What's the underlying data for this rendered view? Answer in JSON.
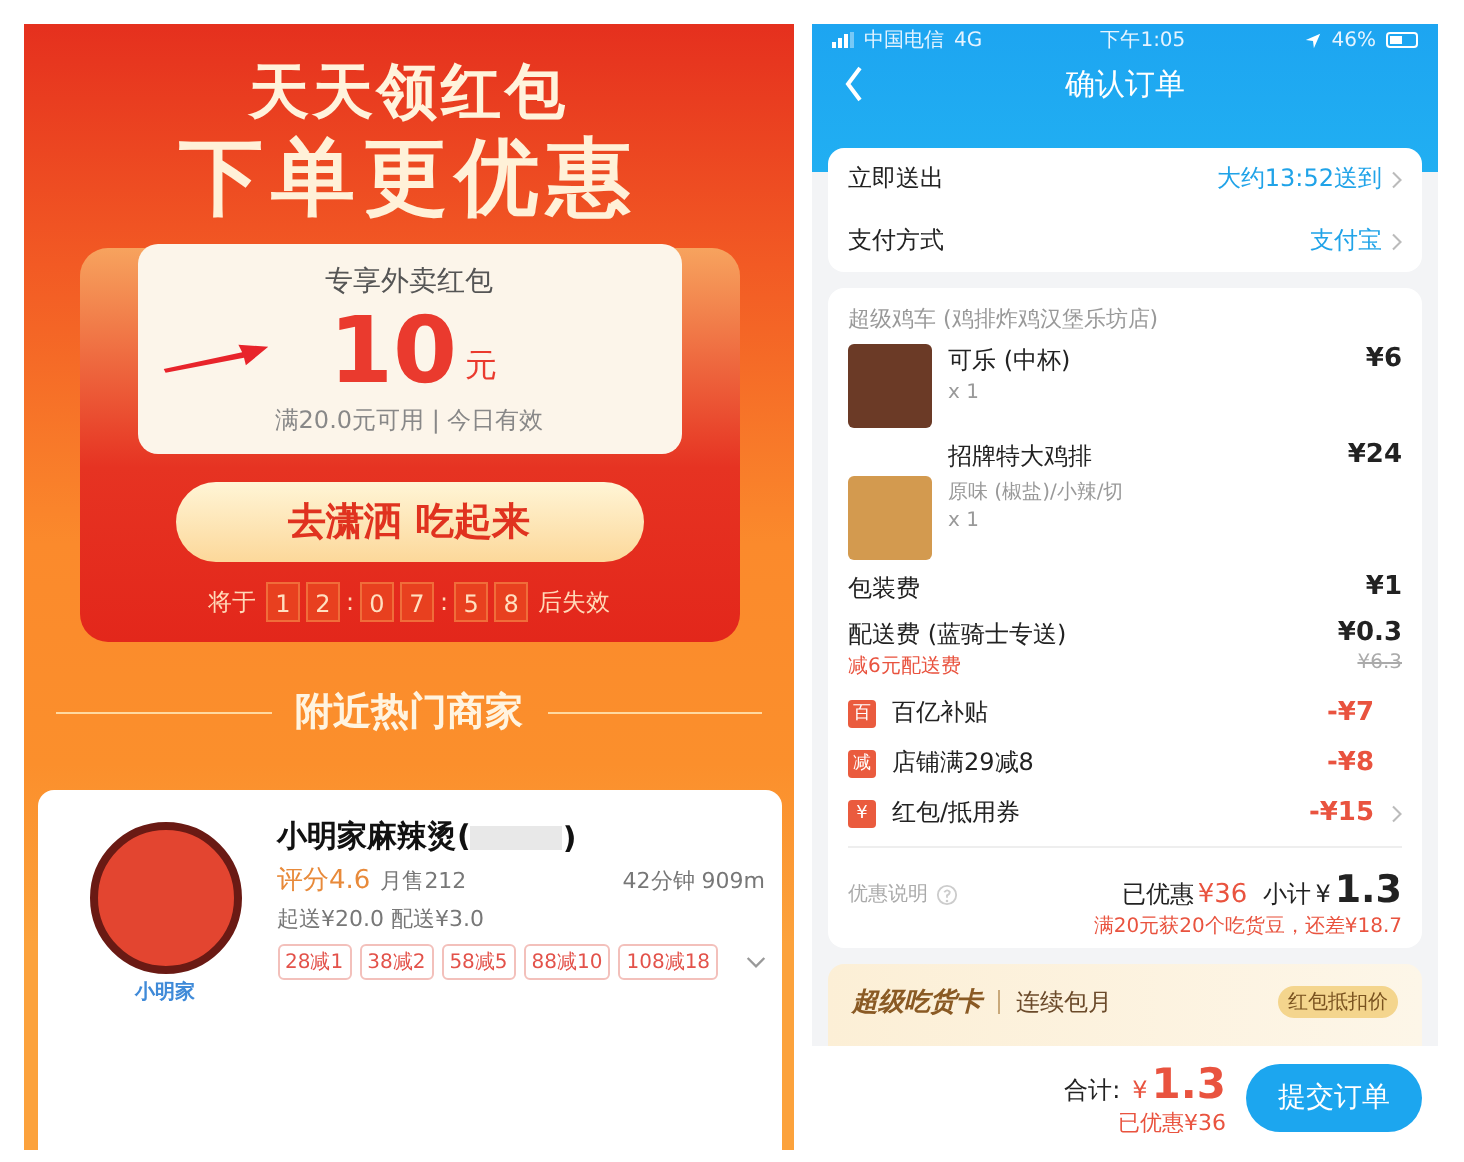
{
  "left_panel": {
    "banner": {
      "title_top": "天天领红包",
      "title_bottom": "下单更优惠"
    },
    "coupon": {
      "label": "专享外卖红包",
      "amount": "10",
      "unit": "元",
      "terms": "满20.0元可用 | 今日有效"
    },
    "cta_button": "去潇洒 吃起来",
    "countdown": {
      "prefix": "将于",
      "digits": [
        "1",
        "2",
        "0",
        "7",
        "5",
        "8"
      ],
      "separator": ":",
      "suffix": "后失效"
    },
    "section_title": "附近热门商家",
    "store": {
      "logo_text": "小明家",
      "name_start": "小明家麻辣烫(",
      "name_end": ")",
      "rating": "评分4.6",
      "monthly_sales": "月售212",
      "eta": "42分钟 909m",
      "fees": "起送¥20.0 配送¥3.0",
      "tags": [
        "28减1",
        "38减2",
        "58减5",
        "88减10",
        "108减18"
      ]
    }
  },
  "right_panel": {
    "status_bar": {
      "carrier": "中国电信",
      "network": "4G",
      "time": "下午1:05",
      "battery": "46%"
    },
    "nav": {
      "title": "确认订单"
    },
    "delivery_rows": [
      {
        "label": "立即送出",
        "value": "大约13:52送到"
      },
      {
        "label": "支付方式",
        "value": "支付宝"
      }
    ],
    "order": {
      "store_name": "超级鸡车 (鸡排炸鸡汉堡乐坊店)",
      "items": [
        {
          "name": "可乐 (中杯)",
          "qty": "x 1",
          "price": "¥6"
        },
        {
          "name": "招牌特大鸡排",
          "options": "原味 (椒盐)/小辣/切",
          "qty": "x 1",
          "price": "¥24"
        }
      ],
      "fees": [
        {
          "label": "包装费",
          "price": "¥1"
        },
        {
          "label": "配送费 (蓝骑士专送)",
          "price": "¥0.3",
          "note": "减6元配送费",
          "old_price": "¥6.3"
        }
      ],
      "discounts": [
        {
          "badge": "百",
          "label": "百亿补贴",
          "amount": "-¥7",
          "chevron": false
        },
        {
          "badge": "减",
          "label": "店铺满29减8",
          "amount": "-¥8",
          "chevron": false
        },
        {
          "badge": "¥",
          "label": "红包/抵用券",
          "amount": "-¥15",
          "chevron": true
        }
      ],
      "summary": {
        "info_label": "优惠说明",
        "saved_label": "已优惠",
        "saved": "¥36",
        "subtotal_label": "小计",
        "subtotal_currency": "¥",
        "subtotal": "1.3",
        "note": "满20元获20个吃货豆，还差¥18.7"
      }
    },
    "membership": {
      "brand": "超级吃货卡",
      "plan": "连续包月",
      "tag": "红包抵扣价"
    },
    "footer": {
      "total_label": "合计:",
      "currency": "¥",
      "total": "1.3",
      "saved": "已优惠¥36",
      "submit": "提交订单"
    }
  }
}
